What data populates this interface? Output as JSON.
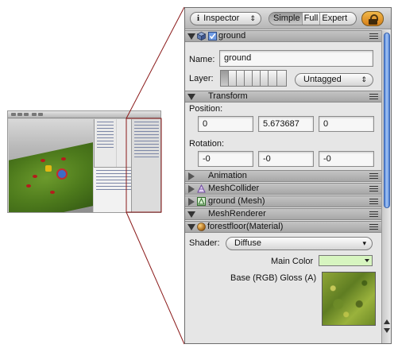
{
  "inspector": {
    "title": "Inspector",
    "modes": [
      "Simple",
      "Full",
      "Expert"
    ],
    "selected_mode": "Simple",
    "lock_icon": "lock-icon",
    "scroll_fraction": 0.58
  },
  "gameobject": {
    "name_header": "ground",
    "active": true,
    "name_label": "Name:",
    "name_value": "ground",
    "layer_label": "Layer:",
    "tag_value": "Untagged"
  },
  "transform": {
    "title": "Transform",
    "position_label": "Position:",
    "position": [
      "0",
      "5.673687",
      "0"
    ],
    "rotation_label": "Rotation:",
    "rotation": [
      "-0",
      "-0",
      "-0"
    ]
  },
  "components": [
    {
      "title": "Animation",
      "icon": ""
    },
    {
      "title": "MeshCollider",
      "icon": "mesh-collider-icon"
    },
    {
      "title": "ground (Mesh)",
      "icon": "mesh-icon"
    },
    {
      "title": "MeshRenderer",
      "icon": ""
    }
  ],
  "material": {
    "title": "forestfloor(Material)",
    "shader_label": "Shader:",
    "shader_value": "Diffuse",
    "main_color_label": "Main Color",
    "main_color": "#d7f5c0",
    "texture_label": "Base (RGB) Gloss (A)"
  },
  "colors": {
    "zoom_lines": "#8b1a1a",
    "scrollbar": "#4b7fd6",
    "lock_button": "#e89a2c"
  }
}
